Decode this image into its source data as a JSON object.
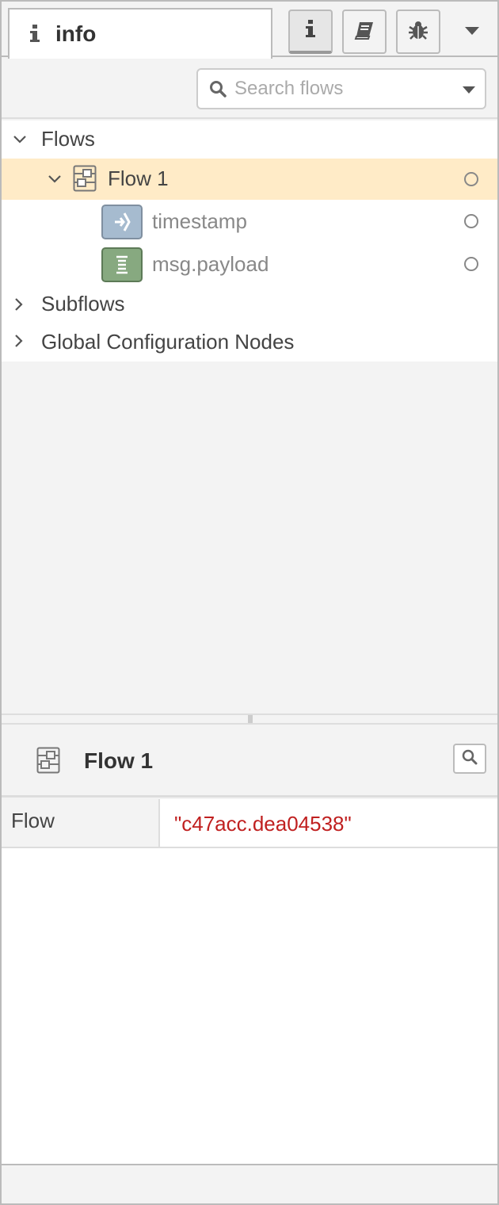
{
  "header": {
    "active_tab": {
      "label": "info",
      "icon": "info-icon"
    },
    "buttons": [
      {
        "icon": "info-icon",
        "active": true
      },
      {
        "icon": "book-icon",
        "active": false
      },
      {
        "icon": "bug-icon",
        "active": false
      },
      {
        "icon": "caret-down-icon",
        "active": false
      }
    ]
  },
  "search": {
    "placeholder": "Search flows"
  },
  "tree": {
    "flows_label": "Flows",
    "flow": {
      "label": "Flow 1",
      "selected": true
    },
    "nodes": [
      {
        "label": "timestamp",
        "type": "inject",
        "color": "#a6bbcf"
      },
      {
        "label": "msg.payload",
        "type": "debug",
        "color": "#87a980"
      }
    ],
    "subflows_label": "Subflows",
    "global_config_label": "Global Configuration Nodes"
  },
  "detail": {
    "title": "Flow 1",
    "properties": [
      {
        "key": "Flow",
        "value": "\"c47acc.dea04538\""
      }
    ]
  },
  "colors": {
    "selected_row": "#ffebc7",
    "value_text": "#c02020"
  }
}
